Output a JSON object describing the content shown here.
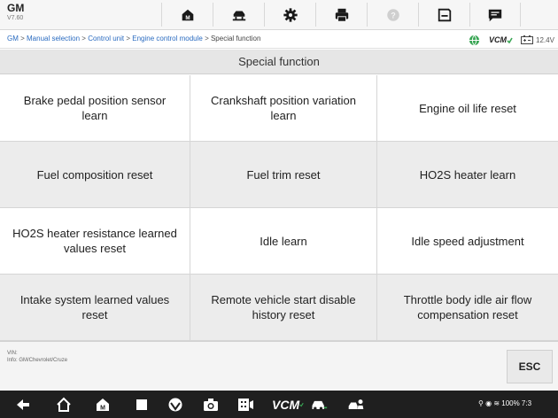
{
  "app": {
    "name": "GM",
    "version": "V7.60"
  },
  "toolbar": {
    "icons": [
      "home-icon",
      "vehicle-lift-icon",
      "settings-gear-icon",
      "print-icon",
      "help-icon",
      "save-icon",
      "message-icon"
    ]
  },
  "breadcrumb": {
    "items": [
      "GM",
      "Manual selection",
      "Control unit",
      "Engine control module",
      "Special function"
    ],
    "separator": " > "
  },
  "status": {
    "vcm_label": "VCM",
    "battery": "12.4V"
  },
  "page": {
    "title": "Special function"
  },
  "functions": [
    "Brake pedal position sensor learn",
    "Crankshaft position variation learn",
    "Engine oil life reset",
    "Fuel composition reset",
    "Fuel trim reset",
    "HO2S heater learn",
    "HO2S heater resistance learned values reset",
    "Idle learn",
    "Idle speed adjustment",
    "Intake system learned values reset",
    "Remote vehicle start disable history reset",
    "Throttle body idle air flow compensation reset"
  ],
  "footer": {
    "vin_label": "VIN:",
    "info": "Info: GM/Chevrolet/Cruze",
    "esc_label": "ESC"
  },
  "navbar": {
    "vcm_label": "VCM",
    "system_status": "100% 7:3"
  },
  "colors": {
    "link": "#2a6bc0",
    "accent_green": "#3aa655",
    "row_alt": "#ececec",
    "navbar_bg": "#1f1f1f"
  }
}
